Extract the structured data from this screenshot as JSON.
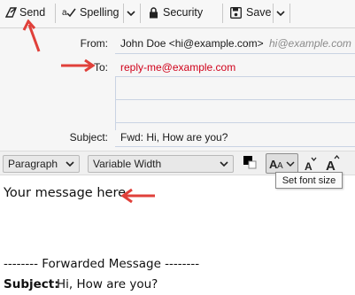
{
  "toolbar": {
    "send_label": "Send",
    "spelling_label": "Spelling",
    "security_label": "Security",
    "save_label": "Save"
  },
  "header": {
    "from_label": "From:",
    "from_value": "John Doe <hi@example.com>",
    "from_hint": "hi@example.com",
    "to_label": "To:",
    "to_value": "reply-me@example.com",
    "subject_label": "Subject:",
    "subject_value": "Fwd: Hi, How are you?"
  },
  "format_bar": {
    "paragraph_value": "Paragraph",
    "font_value": "Variable Width",
    "tooltip": "Set font size"
  },
  "editor": {
    "message": "Your message here.",
    "forward_header": "-------- Forwarded Message --------",
    "subject_label": "Subject:",
    "subject_value": "Hi, How are you?"
  },
  "colors": {
    "annotation_arrow": "#e0403a",
    "to_value": "#d0021b",
    "hint_text": "#8a8a8a"
  }
}
